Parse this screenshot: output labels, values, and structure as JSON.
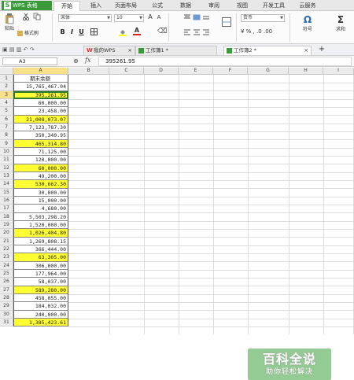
{
  "app": {
    "name": "WPS 表格",
    "menu_tabs": [
      "开始",
      "插入",
      "页面布局",
      "公式",
      "数据",
      "审阅",
      "视图",
      "开发工具",
      "云服务"
    ]
  },
  "ribbon": {
    "paste_label": "粘贴",
    "cut_label": "剪切",
    "format_painter_label": "格式刷",
    "font_name": "宋体",
    "font_size": "10",
    "number_format": "货币",
    "symbol_label": "符号",
    "sum_label": "求和"
  },
  "doc_tabs": {
    "my_wps": "我的WPS",
    "workbook1": "工作簿1 *",
    "workbook2": "工作簿2 *",
    "new_tab": "+"
  },
  "formula_bar": {
    "name_box": "A3",
    "fx_label": "fx",
    "value": "395261.95"
  },
  "columns": [
    "A",
    "B",
    "C",
    "D",
    "E",
    "F",
    "G",
    "H",
    "I"
  ],
  "column_a_header": "期末余额",
  "rows": [
    {
      "n": "1",
      "v": "期末余额",
      "y": false
    },
    {
      "n": "2",
      "v": "15,765,467.04",
      "y": false
    },
    {
      "n": "3",
      "v": "395,261.95",
      "y": true
    },
    {
      "n": "4",
      "v": "60,000.00",
      "y": false
    },
    {
      "n": "5",
      "v": "23,458.00",
      "y": false
    },
    {
      "n": "6",
      "v": "21,008,073.07",
      "y": true
    },
    {
      "n": "7",
      "v": "7,123,787.30",
      "y": false
    },
    {
      "n": "8",
      "v": "350,340.95",
      "y": false
    },
    {
      "n": "9",
      "v": "465,314.80",
      "y": true
    },
    {
      "n": "10",
      "v": "71,125.00",
      "y": false
    },
    {
      "n": "11",
      "v": "120,000.00",
      "y": false
    },
    {
      "n": "12",
      "v": "60,000.00",
      "y": true
    },
    {
      "n": "13",
      "v": "49,200.00",
      "y": false
    },
    {
      "n": "14",
      "v": "530,662.30",
      "y": true
    },
    {
      "n": "15",
      "v": "30,000.00",
      "y": false
    },
    {
      "n": "16",
      "v": "15,000.00",
      "y": false
    },
    {
      "n": "17",
      "v": "4,680.00",
      "y": false
    },
    {
      "n": "18",
      "v": "5,503,298.20",
      "y": false
    },
    {
      "n": "19",
      "v": "1,520,000.00",
      "y": false
    },
    {
      "n": "20",
      "v": "1,026,404.80",
      "y": true
    },
    {
      "n": "21",
      "v": "1,269,808.15",
      "y": false
    },
    {
      "n": "22",
      "v": "366,444.00",
      "y": false
    },
    {
      "n": "23",
      "v": "63,305.00",
      "y": true
    },
    {
      "n": "24",
      "v": "306,000.00",
      "y": false
    },
    {
      "n": "25",
      "v": "177,964.00",
      "y": false
    },
    {
      "n": "26",
      "v": "58,037.00",
      "y": false
    },
    {
      "n": "27",
      "v": "589,280.00",
      "y": true
    },
    {
      "n": "28",
      "v": "458,055.00",
      "y": false
    },
    {
      "n": "29",
      "v": "184,032.00",
      "y": false
    },
    {
      "n": "30",
      "v": "240,000.00",
      "y": false
    },
    {
      "n": "31",
      "v": "1,385,423.61",
      "y": true
    }
  ],
  "watermark": {
    "title": "百科全说",
    "subtitle": "助你轻松解决"
  }
}
